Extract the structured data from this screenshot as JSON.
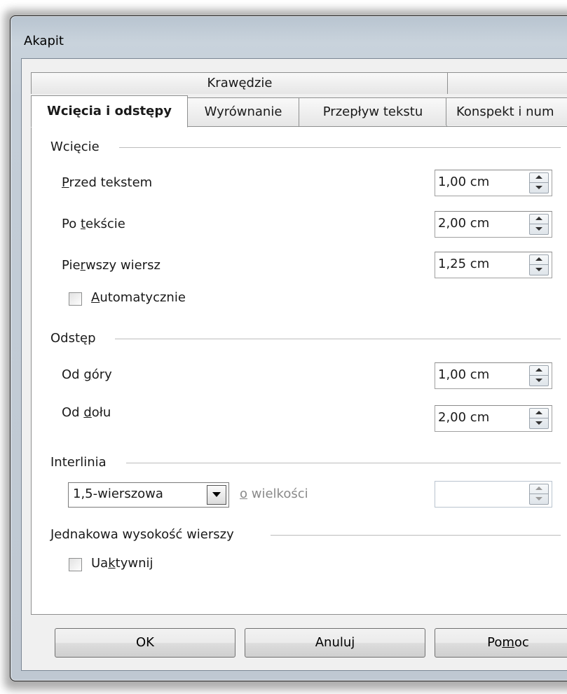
{
  "window": {
    "title": "Akapit"
  },
  "tabs": {
    "row1": [
      "Krawędzie",
      ""
    ],
    "row2": [
      {
        "label": "Wcięcia i odstępy",
        "selected": true
      },
      {
        "label": "Wyrównanie",
        "selected": false
      },
      {
        "label": "Przepływ tekstu",
        "selected": false
      },
      {
        "label": "Konspekt i num",
        "selected": false
      }
    ]
  },
  "indent": {
    "group_label": "Wcięcie",
    "before_text": {
      "pre": "",
      "mnemonic": "P",
      "post": "rzed tekstem",
      "value": "1,00 cm"
    },
    "after_text": {
      "pre": "Po ",
      "mnemonic": "t",
      "post": "ekście",
      "value": "2,00 cm"
    },
    "first_line": {
      "pre": "Pie",
      "mnemonic": "r",
      "post": "wszy wiersz",
      "value": "1,25 cm"
    },
    "automatic": {
      "pre": "",
      "mnemonic": "A",
      "post": "utomatycznie",
      "checked": false
    }
  },
  "spacing": {
    "group_label": "Odstęp",
    "above": {
      "pre": "Od ",
      "mnemonic": "g",
      "post": "óry",
      "value": "1,00 cm"
    },
    "below": {
      "pre": "Od ",
      "mnemonic": "d",
      "post": "ołu",
      "value": "2,00 cm"
    }
  },
  "line_spacing": {
    "group_label": "Interlinia",
    "selected": "1,5-wierszowa",
    "of_size": {
      "pre": "",
      "mnemonic": "o",
      "post": " wielkości"
    },
    "size_value": ""
  },
  "register": {
    "group_label": "Jednakowa wysokość wierszy",
    "activate": {
      "pre": "Ua",
      "mnemonic": "k",
      "post": "tywnij",
      "checked": false
    }
  },
  "buttons": {
    "ok": "OK",
    "cancel": "Anuluj",
    "help": {
      "pre": "Po",
      "mnemonic": "m",
      "post": "oc"
    }
  },
  "colors": {
    "disabled_text": "#8a8a8a",
    "panel_bg": "#ffffff",
    "dialog_bg": "#f0f0f0"
  }
}
